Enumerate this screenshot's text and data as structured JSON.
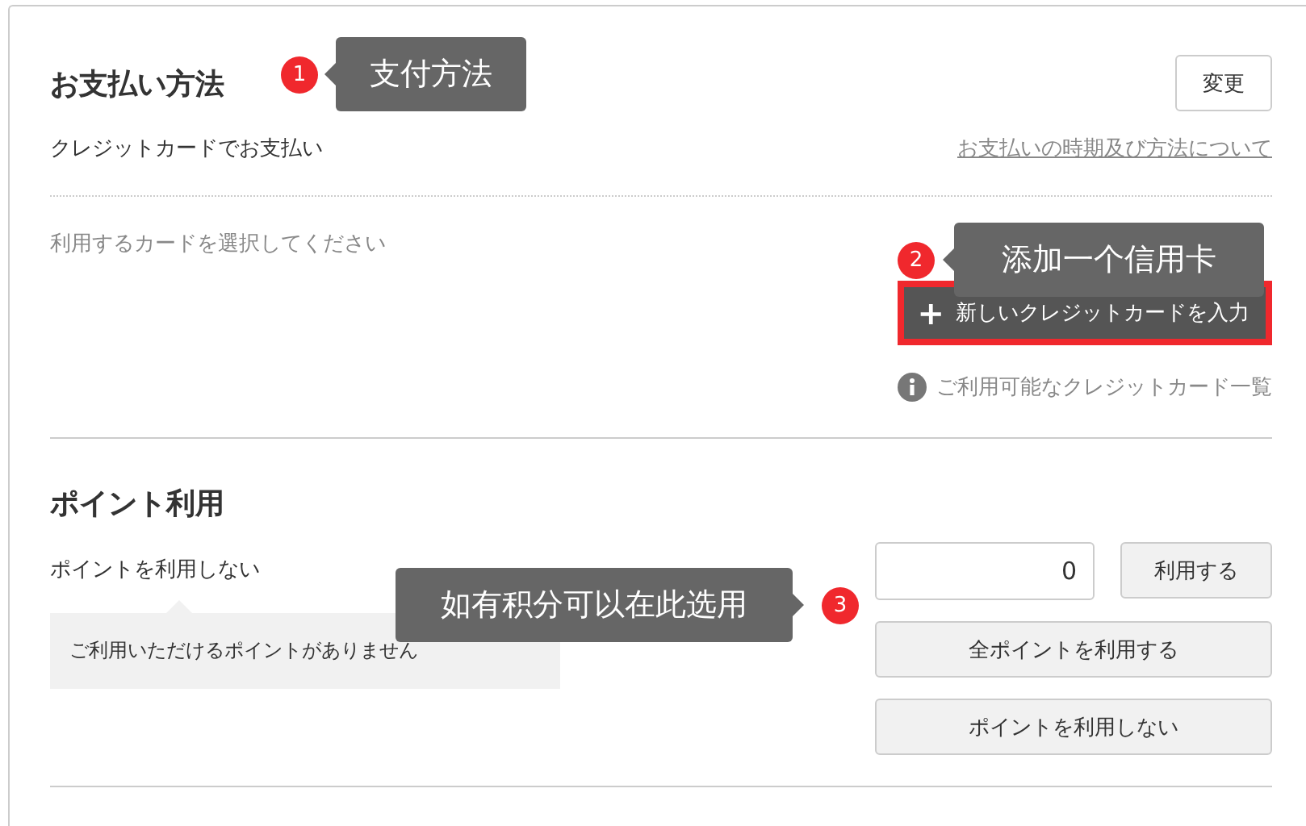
{
  "payment": {
    "title": "お支払い方法",
    "change_button": "変更",
    "method": "クレジットカードでお支払い",
    "link": "お支払いの時期及び方法について",
    "prompt": "利用するカードを選択してください",
    "add_card_button": {
      "icon": "+",
      "label": "新しいクレジットカードを入力",
      "highlighted": true
    },
    "info_link": "ご利用可能なクレジットカード一覧"
  },
  "points": {
    "title": "ポイント利用",
    "status": "ポイントを利用しない",
    "notice": "ご利用いただけるポイントがありません",
    "input_value": "0",
    "apply_button": "利用する",
    "use_all_button": "全ポイントを利用する",
    "dont_use_button": "ポイントを利用しない"
  },
  "callouts": [
    {
      "number": "1",
      "text": "支付方法"
    },
    {
      "number": "2",
      "text": "添加一个信用卡"
    },
    {
      "number": "3",
      "text": "如有积分可以在此选用"
    }
  ]
}
